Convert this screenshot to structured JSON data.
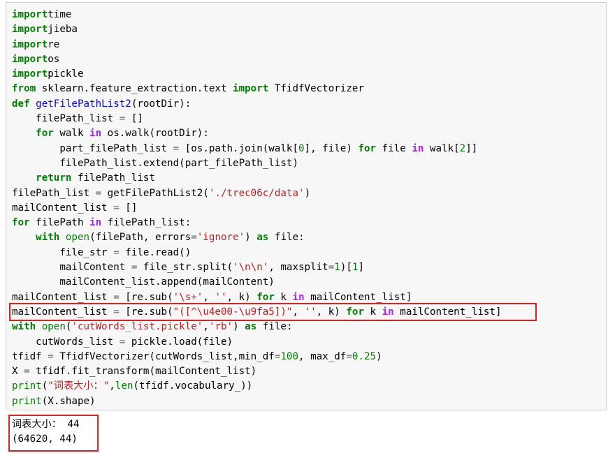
{
  "code_cell": {
    "lines": [
      [
        [
          "kw",
          "import"
        ],
        [
          "",
          "time"
        ]
      ],
      [
        [
          "kw",
          "import"
        ],
        [
          "",
          "jieba"
        ]
      ],
      [
        [
          "kw",
          "import"
        ],
        [
          "",
          "re"
        ]
      ],
      [
        [
          "kw",
          "import"
        ],
        [
          "",
          "os"
        ]
      ],
      [
        [
          "kw",
          "import"
        ],
        [
          "",
          "pickle"
        ]
      ],
      [
        [
          "kw",
          "from"
        ],
        [
          "",
          " sklearn.feature_extraction.text "
        ],
        [
          "kw",
          "import"
        ],
        [
          "",
          " TfidfVectorizer"
        ]
      ],
      [
        [
          "kw",
          "def"
        ],
        [
          "",
          " "
        ],
        [
          "fn",
          "getFilePathList2"
        ],
        [
          "",
          "(rootDir):"
        ]
      ],
      [
        [
          "",
          "    filePath_list "
        ],
        [
          "op",
          "="
        ],
        [
          "",
          " []"
        ]
      ],
      [
        [
          "",
          "    "
        ],
        [
          "kw",
          "for"
        ],
        [
          "",
          " walk "
        ],
        [
          "ow",
          "in"
        ],
        [
          "",
          " os.walk(rootDir):"
        ]
      ],
      [
        [
          "",
          "        part_filePath_list "
        ],
        [
          "op",
          "="
        ],
        [
          "",
          " [os.path.join(walk["
        ],
        [
          "mi",
          "0"
        ],
        [
          "",
          "], file) "
        ],
        [
          "kw",
          "for"
        ],
        [
          "",
          " file "
        ],
        [
          "ow",
          "in"
        ],
        [
          "",
          " walk["
        ],
        [
          "mi",
          "2"
        ],
        [
          "",
          "]]"
        ]
      ],
      [
        [
          "",
          "        filePath_list.extend(part_filePath_list)"
        ]
      ],
      [
        [
          "",
          "    "
        ],
        [
          "kw",
          "return"
        ],
        [
          "",
          " filePath_list"
        ]
      ],
      [
        [
          "",
          "filePath_list "
        ],
        [
          "op",
          "="
        ],
        [
          "",
          " getFilePathList2("
        ],
        [
          "st",
          "'./trec06c/data'"
        ],
        [
          "",
          ")"
        ]
      ],
      [
        [
          "",
          "mailContent_list "
        ],
        [
          "op",
          "="
        ],
        [
          "",
          " []"
        ]
      ],
      [
        [
          "kw",
          "for"
        ],
        [
          "",
          " filePath "
        ],
        [
          "ow",
          "in"
        ],
        [
          "",
          " filePath_list:"
        ]
      ],
      [
        [
          "",
          "    "
        ],
        [
          "kw",
          "with"
        ],
        [
          "",
          " "
        ],
        [
          "nb",
          "open"
        ],
        [
          "",
          "(filePath, errors"
        ],
        [
          "op",
          "="
        ],
        [
          "st",
          "'ignore'"
        ],
        [
          "",
          ") "
        ],
        [
          "kw",
          "as"
        ],
        [
          "",
          " file:"
        ]
      ],
      [
        [
          "",
          "        file_str "
        ],
        [
          "op",
          "="
        ],
        [
          "",
          " file.read()"
        ]
      ],
      [
        [
          "",
          "        mailContent "
        ],
        [
          "op",
          "="
        ],
        [
          "",
          " file_str.split("
        ],
        [
          "st",
          "'\\n\\n'"
        ],
        [
          "",
          ", maxsplit"
        ],
        [
          "op",
          "="
        ],
        [
          "mi",
          "1"
        ],
        [
          "",
          ")["
        ],
        [
          "mi",
          "1"
        ],
        [
          "",
          "]"
        ]
      ],
      [
        [
          "",
          "        mailContent_list.append(mailContent)"
        ]
      ],
      [
        [
          "",
          "mailContent_list "
        ],
        [
          "op",
          "="
        ],
        [
          "",
          " [re.sub("
        ],
        [
          "st",
          "'\\s+'"
        ],
        [
          "",
          ", "
        ],
        [
          "st",
          "''"
        ],
        [
          "",
          ", k) "
        ],
        [
          "kw",
          "for"
        ],
        [
          "",
          " k "
        ],
        [
          "ow",
          "in"
        ],
        [
          "",
          " mailContent_list]"
        ]
      ],
      [
        [
          "",
          "mailContent_list "
        ],
        [
          "op",
          "="
        ],
        [
          "",
          " [re.sub("
        ],
        [
          "st",
          "\"([^\\u4e00-\\u9fa5])\""
        ],
        [
          "",
          ", "
        ],
        [
          "st",
          "''"
        ],
        [
          "",
          ", k) "
        ],
        [
          "kw",
          "for"
        ],
        [
          "",
          " k "
        ],
        [
          "ow",
          "in"
        ],
        [
          "",
          " mailContent_list]"
        ]
      ],
      [
        [
          "kw",
          "with"
        ],
        [
          "",
          " "
        ],
        [
          "nb",
          "open"
        ],
        [
          "",
          "("
        ],
        [
          "st",
          "'cutWords_list.pickle'"
        ],
        [
          "",
          ","
        ],
        [
          "st",
          "'rb'"
        ],
        [
          "",
          ") "
        ],
        [
          "kw",
          "as"
        ],
        [
          "",
          " file:"
        ]
      ],
      [
        [
          "",
          "    cutWords_list "
        ],
        [
          "op",
          "="
        ],
        [
          "",
          " pickle.load(file)"
        ]
      ],
      [
        [
          "",
          "tfidf "
        ],
        [
          "op",
          "="
        ],
        [
          "",
          " TfidfVectorizer(cutWords_list,min_df"
        ],
        [
          "op",
          "="
        ],
        [
          "mi",
          "100"
        ],
        [
          "",
          ", max_df"
        ],
        [
          "op",
          "="
        ],
        [
          "mi",
          "0.25"
        ],
        [
          "",
          ")"
        ]
      ],
      [
        [
          "",
          "X "
        ],
        [
          "op",
          "="
        ],
        [
          "",
          " tfidf.fit_transform(mailContent_list)"
        ]
      ],
      [
        [
          "nb",
          "print"
        ],
        [
          "",
          "("
        ],
        [
          "st",
          "\"词表大小：\""
        ],
        [
          "",
          ","
        ],
        [
          "nb",
          "len"
        ],
        [
          "",
          "(tfidf.vocabulary_))"
        ]
      ],
      [
        [
          "nb",
          "print"
        ],
        [
          "",
          "(X.shape)"
        ]
      ]
    ]
  },
  "output": {
    "line1": "词表大小： 44",
    "line2": "(64620, 44)"
  },
  "colors": {
    "highlight_box": "#e02020",
    "cell_background": "#f7f7f7"
  }
}
